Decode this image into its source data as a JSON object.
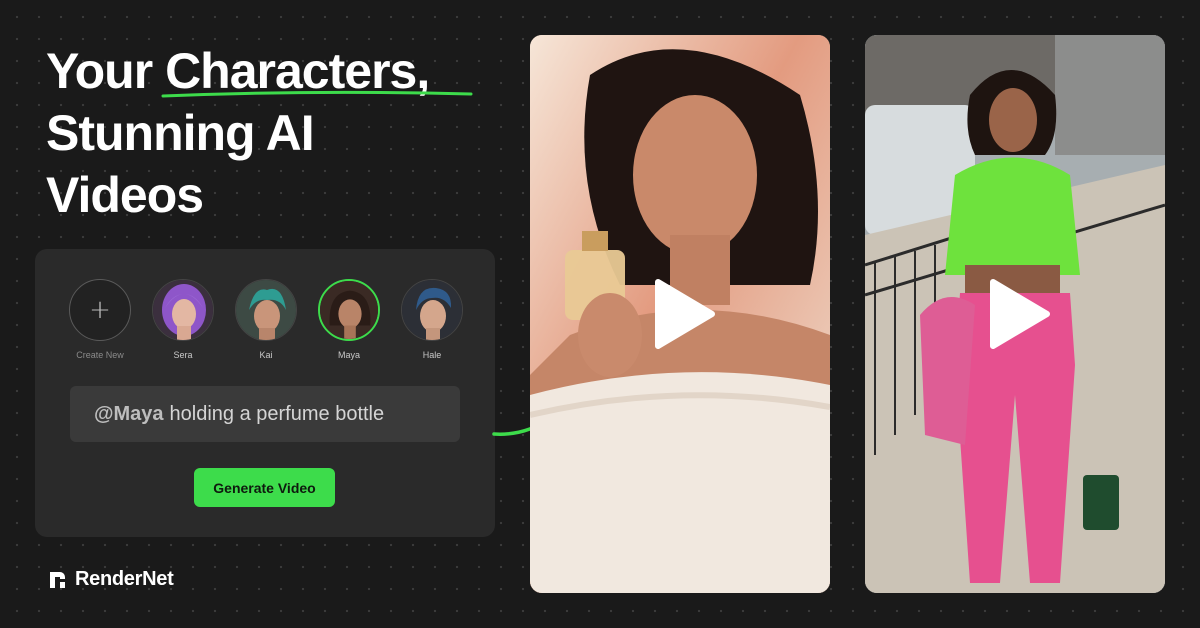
{
  "headline": {
    "line1_prefix": "Your ",
    "line1_highlight": "Characters,",
    "line2": "Stunning AI",
    "line3": "Videos"
  },
  "characters": [
    {
      "label": "Create New",
      "type": "create",
      "icon": "plus-icon"
    },
    {
      "label": "Sera",
      "type": "character",
      "hair_color": "#8e56c9"
    },
    {
      "label": "Kai",
      "type": "character",
      "hair_color": "#2e9c92"
    },
    {
      "label": "Maya",
      "type": "character",
      "selected": true,
      "hair_color": "#2a1c17"
    },
    {
      "label": "Hale",
      "type": "character",
      "hair_color": "#2f5a8a"
    }
  ],
  "prompt": {
    "mention": "@Maya",
    "text": "holding a perfume bottle"
  },
  "generate_button": "Generate Video",
  "brand": {
    "name": "RenderNet"
  },
  "colors": {
    "accent": "#3ddc4b",
    "background": "#1a1a1a",
    "panel": "#2a2a2a",
    "prompt_bg": "#3a3a3a"
  },
  "videos": [
    {
      "subject": "woman holding perfume bottle",
      "icon": "play-icon"
    },
    {
      "subject": "woman in green top and pink suit walking",
      "icon": "play-icon"
    }
  ]
}
